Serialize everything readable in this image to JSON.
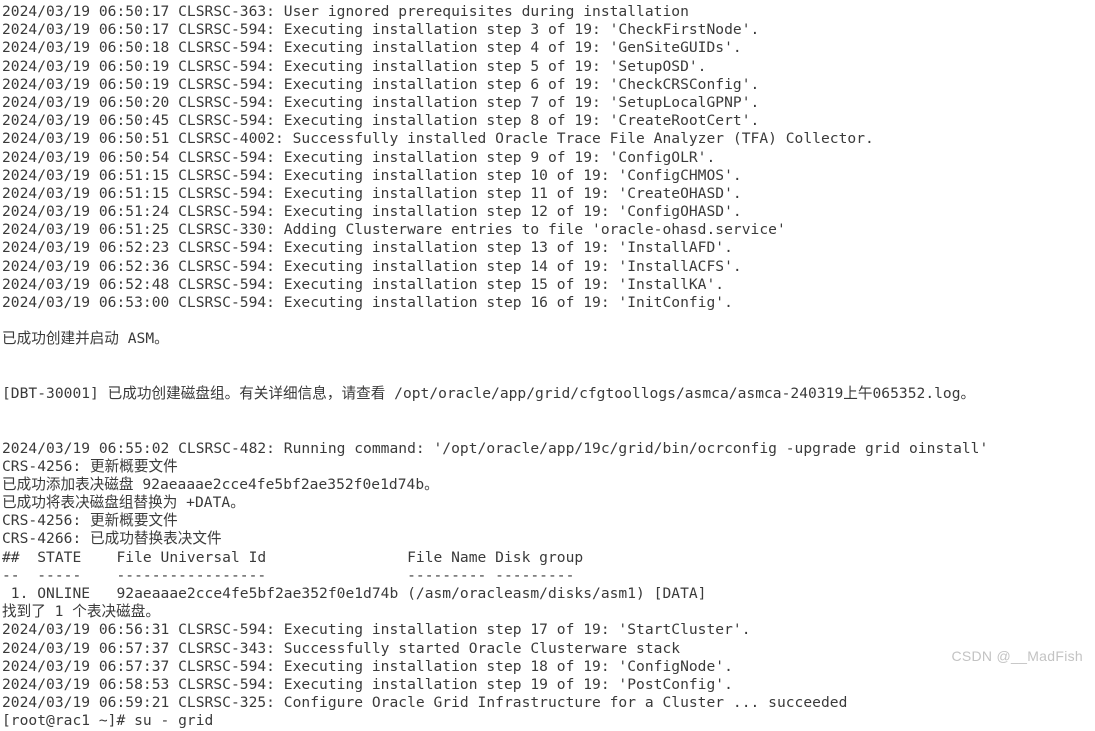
{
  "window": {
    "title": "Oracle Grid Infrastructure root.sh Terminal Output",
    "background_color": "#ffffff",
    "text_color": "#3a3a3a",
    "watermark_color": "#c3c3c3",
    "top_sliver_color": "#e8e8e8"
  },
  "watermark": {
    "text": "CSDN @__MadFish"
  },
  "terminal": {
    "lines": [
      {
        "id": "line-01",
        "text": "2024/03/19 06:50:17 CLSRSC-363: User ignored prerequisites during installation",
        "cjk": false
      },
      {
        "id": "line-02",
        "text": "2024/03/19 06:50:17 CLSRSC-594: Executing installation step 3 of 19: 'CheckFirstNode'.",
        "cjk": false
      },
      {
        "id": "line-03",
        "text": "2024/03/19 06:50:18 CLSRSC-594: Executing installation step 4 of 19: 'GenSiteGUIDs'.",
        "cjk": false
      },
      {
        "id": "line-04",
        "text": "2024/03/19 06:50:19 CLSRSC-594: Executing installation step 5 of 19: 'SetupOSD'.",
        "cjk": false
      },
      {
        "id": "line-05",
        "text": "2024/03/19 06:50:19 CLSRSC-594: Executing installation step 6 of 19: 'CheckCRSConfig'.",
        "cjk": false
      },
      {
        "id": "line-06",
        "text": "2024/03/19 06:50:20 CLSRSC-594: Executing installation step 7 of 19: 'SetupLocalGPNP'.",
        "cjk": false
      },
      {
        "id": "line-07",
        "text": "2024/03/19 06:50:45 CLSRSC-594: Executing installation step 8 of 19: 'CreateRootCert'.",
        "cjk": false
      },
      {
        "id": "line-08",
        "text": "2024/03/19 06:50:51 CLSRSC-4002: Successfully installed Oracle Trace File Analyzer (TFA) Collector.",
        "cjk": false
      },
      {
        "id": "line-09",
        "text": "2024/03/19 06:50:54 CLSRSC-594: Executing installation step 9 of 19: 'ConfigOLR'.",
        "cjk": false
      },
      {
        "id": "line-10",
        "text": "2024/03/19 06:51:15 CLSRSC-594: Executing installation step 10 of 19: 'ConfigCHMOS'.",
        "cjk": false
      },
      {
        "id": "line-11",
        "text": "2024/03/19 06:51:15 CLSRSC-594: Executing installation step 11 of 19: 'CreateOHASD'.",
        "cjk": false
      },
      {
        "id": "line-12",
        "text": "2024/03/19 06:51:24 CLSRSC-594: Executing installation step 12 of 19: 'ConfigOHASD'.",
        "cjk": false
      },
      {
        "id": "line-13",
        "text": "2024/03/19 06:51:25 CLSRSC-330: Adding Clusterware entries to file 'oracle-ohasd.service'",
        "cjk": false
      },
      {
        "id": "line-14",
        "text": "2024/03/19 06:52:23 CLSRSC-594: Executing installation step 13 of 19: 'InstallAFD'.",
        "cjk": false
      },
      {
        "id": "line-15",
        "text": "2024/03/19 06:52:36 CLSRSC-594: Executing installation step 14 of 19: 'InstallACFS'.",
        "cjk": false
      },
      {
        "id": "line-16",
        "text": "2024/03/19 06:52:48 CLSRSC-594: Executing installation step 15 of 19: 'InstallKA'.",
        "cjk": false
      },
      {
        "id": "line-17",
        "text": "2024/03/19 06:53:00 CLSRSC-594: Executing installation step 16 of 19: 'InitConfig'.",
        "cjk": false
      },
      {
        "id": "line-18",
        "text": "",
        "cjk": false
      },
      {
        "id": "line-19",
        "text": "已成功创建并启动 ASM。",
        "cjk": true
      },
      {
        "id": "line-20",
        "text": "",
        "cjk": false
      },
      {
        "id": "line-21",
        "text": "",
        "cjk": false
      },
      {
        "id": "line-22",
        "text": "[DBT-30001] 已成功创建磁盘组。有关详细信息，请查看 /opt/oracle/app/grid/cfgtoollogs/asmca/asmca-240319上午065352.log。",
        "cjk": true
      },
      {
        "id": "line-23",
        "text": "",
        "cjk": false
      },
      {
        "id": "line-24",
        "text": "",
        "cjk": false
      },
      {
        "id": "line-25",
        "text": "2024/03/19 06:55:02 CLSRSC-482: Running command: '/opt/oracle/app/19c/grid/bin/ocrconfig -upgrade grid oinstall'",
        "cjk": false
      },
      {
        "id": "line-26",
        "text": "CRS-4256: 更新概要文件",
        "cjk": true
      },
      {
        "id": "line-27",
        "text": "已成功添加表决磁盘 92aeaaae2cce4fe5bf2ae352f0e1d74b。",
        "cjk": true
      },
      {
        "id": "line-28",
        "text": "已成功将表决磁盘组替换为 +DATA。",
        "cjk": true
      },
      {
        "id": "line-29",
        "text": "CRS-4256: 更新概要文件",
        "cjk": true
      },
      {
        "id": "line-30",
        "text": "CRS-4266: 已成功替换表决文件",
        "cjk": true
      },
      {
        "id": "line-31",
        "text": "##  STATE    File Universal Id                File Name Disk group",
        "cjk": false
      },
      {
        "id": "line-32",
        "text": "--  -----    -----------------                --------- ---------",
        "cjk": false
      },
      {
        "id": "line-33",
        "text": " 1. ONLINE   92aeaaae2cce4fe5bf2ae352f0e1d74b (/asm/oracleasm/disks/asm1) [DATA]",
        "cjk": false
      },
      {
        "id": "line-34",
        "text": "找到了 1 个表决磁盘。",
        "cjk": true
      },
      {
        "id": "line-35",
        "text": "2024/03/19 06:56:31 CLSRSC-594: Executing installation step 17 of 19: 'StartCluster'.",
        "cjk": false
      },
      {
        "id": "line-36",
        "text": "2024/03/19 06:57:37 CLSRSC-343: Successfully started Oracle Clusterware stack",
        "cjk": false
      },
      {
        "id": "line-37",
        "text": "2024/03/19 06:57:37 CLSRSC-594: Executing installation step 18 of 19: 'ConfigNode'.",
        "cjk": false
      },
      {
        "id": "line-38",
        "text": "2024/03/19 06:58:53 CLSRSC-594: Executing installation step 19 of 19: 'PostConfig'.",
        "cjk": false
      },
      {
        "id": "line-39",
        "text": "2024/03/19 06:59:21 CLSRSC-325: Configure Oracle Grid Infrastructure for a Cluster ... succeeded",
        "cjk": false
      },
      {
        "id": "line-40",
        "text": "[root@rac1 ~]# su - grid",
        "cjk": false
      }
    ]
  }
}
